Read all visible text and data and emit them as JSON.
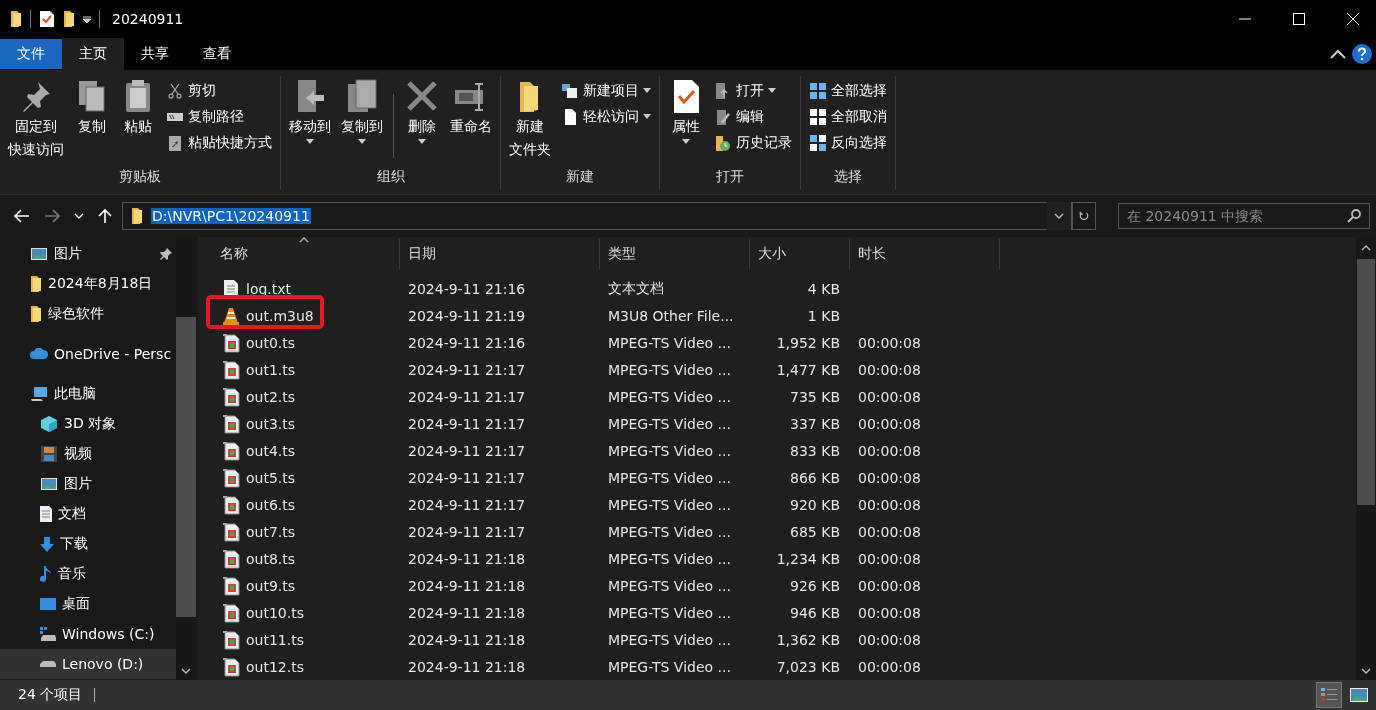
{
  "window": {
    "title": "20240911"
  },
  "ribbon_tabs": [
    {
      "label": "文件",
      "kind": "file",
      "selected": false
    },
    {
      "label": "主页",
      "kind": "tab",
      "selected": true
    },
    {
      "label": "共享",
      "kind": "tab",
      "selected": false
    },
    {
      "label": "查看",
      "kind": "tab",
      "selected": false
    }
  ],
  "ribbon_groups": [
    {
      "title": "剪贴板",
      "items": [
        {
          "kind": "large",
          "lines": [
            "固定到",
            "快速访问"
          ],
          "dropdown": false
        },
        {
          "kind": "large",
          "lines": [
            "复制"
          ],
          "dropdown": false
        },
        {
          "kind": "large",
          "lines": [
            "粘贴"
          ],
          "dropdown": false
        },
        {
          "kind": "stack",
          "buttons": [
            {
              "label": "剪切",
              "dropdown": false
            },
            {
              "label": "复制路径",
              "dropdown": false
            },
            {
              "label": "粘贴快捷方式",
              "dropdown": false
            }
          ]
        }
      ]
    },
    {
      "title": "组织",
      "items": [
        {
          "kind": "large",
          "lines": [
            "移动到"
          ],
          "dropdown": true
        },
        {
          "kind": "large",
          "lines": [
            "复制到"
          ],
          "dropdown": true
        },
        {
          "kind": "divider"
        },
        {
          "kind": "large",
          "lines": [
            "删除"
          ],
          "dropdown": true
        },
        {
          "kind": "large",
          "lines": [
            "重命名"
          ],
          "dropdown": false
        }
      ]
    },
    {
      "title": "新建",
      "items": [
        {
          "kind": "large",
          "lines": [
            "新建",
            "文件夹"
          ],
          "dropdown": false
        },
        {
          "kind": "stack",
          "buttons": [
            {
              "label": "新建项目",
              "dropdown": true
            },
            {
              "label": "轻松访问",
              "dropdown": true
            }
          ]
        }
      ]
    },
    {
      "title": "打开",
      "items": [
        {
          "kind": "large",
          "lines": [
            "属性"
          ],
          "dropdown": true
        },
        {
          "kind": "stack",
          "buttons": [
            {
              "label": "打开",
              "dropdown": true
            },
            {
              "label": "编辑",
              "dropdown": false
            },
            {
              "label": "历史记录",
              "dropdown": false
            }
          ]
        }
      ]
    },
    {
      "title": "选择",
      "items": [
        {
          "kind": "stack",
          "buttons": [
            {
              "label": "全部选择",
              "dropdown": false
            },
            {
              "label": "全部取消",
              "dropdown": false
            },
            {
              "label": "反向选择",
              "dropdown": false
            }
          ]
        }
      ]
    }
  ],
  "address_bar": {
    "path": "D:\\NVR\\PC1\\20240911",
    "back_enabled": true,
    "forward_enabled": false
  },
  "search": {
    "placeholder": "在 20240911 中搜索"
  },
  "sidebar": {
    "sections": [
      {
        "items": [
          {
            "label": "图片",
            "pinned": true,
            "selected": false
          },
          {
            "label": "2024年8月18日",
            "pinned": false,
            "selected": false
          },
          {
            "label": "绿色软件",
            "pinned": false,
            "selected": false
          }
        ]
      },
      {
        "items": [
          {
            "label": "OneDrive - Persc",
            "pinned": false,
            "selected": false
          }
        ]
      },
      {
        "items": [
          {
            "label": "此电脑",
            "pinned": false,
            "selected": false,
            "children": [
              {
                "label": "3D 对象",
                "pinned": false,
                "selected": false
              },
              {
                "label": "视频",
                "pinned": false,
                "selected": false
              },
              {
                "label": "图片",
                "pinned": false,
                "selected": false
              },
              {
                "label": "文档",
                "pinned": false,
                "selected": false
              },
              {
                "label": "下载",
                "pinned": false,
                "selected": false
              },
              {
                "label": "音乐",
                "pinned": false,
                "selected": false
              },
              {
                "label": "桌面",
                "pinned": false,
                "selected": false
              },
              {
                "label": "Windows (C:)",
                "pinned": false,
                "selected": false
              },
              {
                "label": "Lenovo (D:)",
                "pinned": false,
                "selected": true
              }
            ]
          }
        ]
      }
    ]
  },
  "table": {
    "columns": [
      {
        "label": "名称",
        "sorted": true
      },
      {
        "label": "日期",
        "sorted": false
      },
      {
        "label": "类型",
        "sorted": false
      },
      {
        "label": "大小",
        "sorted": false
      },
      {
        "label": "时长",
        "sorted": false
      }
    ],
    "rows": [
      {
        "kind": "text",
        "name": "log.txt",
        "date": "2024-9-11 21:16",
        "type": "文本文档",
        "size": "4 KB",
        "duration": "",
        "highlighted": false
      },
      {
        "kind": "vlc",
        "name": "out.m3u8",
        "date": "2024-9-11 21:19",
        "type": "M3U8 Other File...",
        "size": "1 KB",
        "duration": "",
        "highlighted": true
      },
      {
        "kind": "video",
        "name": "out0.ts",
        "date": "2024-9-11 21:16",
        "type": "MPEG-TS Video ...",
        "size": "1,952 KB",
        "duration": "00:00:08",
        "highlighted": false
      },
      {
        "kind": "video",
        "name": "out1.ts",
        "date": "2024-9-11 21:17",
        "type": "MPEG-TS Video ...",
        "size": "1,477 KB",
        "duration": "00:00:08",
        "highlighted": false
      },
      {
        "kind": "video",
        "name": "out2.ts",
        "date": "2024-9-11 21:17",
        "type": "MPEG-TS Video ...",
        "size": "735 KB",
        "duration": "00:00:08",
        "highlighted": false
      },
      {
        "kind": "video",
        "name": "out3.ts",
        "date": "2024-9-11 21:17",
        "type": "MPEG-TS Video ...",
        "size": "337 KB",
        "duration": "00:00:08",
        "highlighted": false
      },
      {
        "kind": "video",
        "name": "out4.ts",
        "date": "2024-9-11 21:17",
        "type": "MPEG-TS Video ...",
        "size": "833 KB",
        "duration": "00:00:08",
        "highlighted": false
      },
      {
        "kind": "video",
        "name": "out5.ts",
        "date": "2024-9-11 21:17",
        "type": "MPEG-TS Video ...",
        "size": "866 KB",
        "duration": "00:00:08",
        "highlighted": false
      },
      {
        "kind": "video",
        "name": "out6.ts",
        "date": "2024-9-11 21:17",
        "type": "MPEG-TS Video ...",
        "size": "920 KB",
        "duration": "00:00:08",
        "highlighted": false
      },
      {
        "kind": "video",
        "name": "out7.ts",
        "date": "2024-9-11 21:17",
        "type": "MPEG-TS Video ...",
        "size": "685 KB",
        "duration": "00:00:08",
        "highlighted": false
      },
      {
        "kind": "video",
        "name": "out8.ts",
        "date": "2024-9-11 21:18",
        "type": "MPEG-TS Video ...",
        "size": "1,234 KB",
        "duration": "00:00:08",
        "highlighted": false
      },
      {
        "kind": "video",
        "name": "out9.ts",
        "date": "2024-9-11 21:18",
        "type": "MPEG-TS Video ...",
        "size": "926 KB",
        "duration": "00:00:08",
        "highlighted": false
      },
      {
        "kind": "video",
        "name": "out10.ts",
        "date": "2024-9-11 21:18",
        "type": "MPEG-TS Video ...",
        "size": "946 KB",
        "duration": "00:00:08",
        "highlighted": false
      },
      {
        "kind": "video",
        "name": "out11.ts",
        "date": "2024-9-11 21:18",
        "type": "MPEG-TS Video ...",
        "size": "1,362 KB",
        "duration": "00:00:08",
        "highlighted": false
      },
      {
        "kind": "video",
        "name": "out12.ts",
        "date": "2024-9-11 21:18",
        "type": "MPEG-TS Video ...",
        "size": "7,023 KB",
        "duration": "00:00:08",
        "highlighted": false
      }
    ]
  },
  "status_bar": {
    "count": "24 个项目",
    "views": [
      {
        "kind": "details",
        "selected": true
      },
      {
        "kind": "thumbnails",
        "selected": false
      }
    ]
  }
}
